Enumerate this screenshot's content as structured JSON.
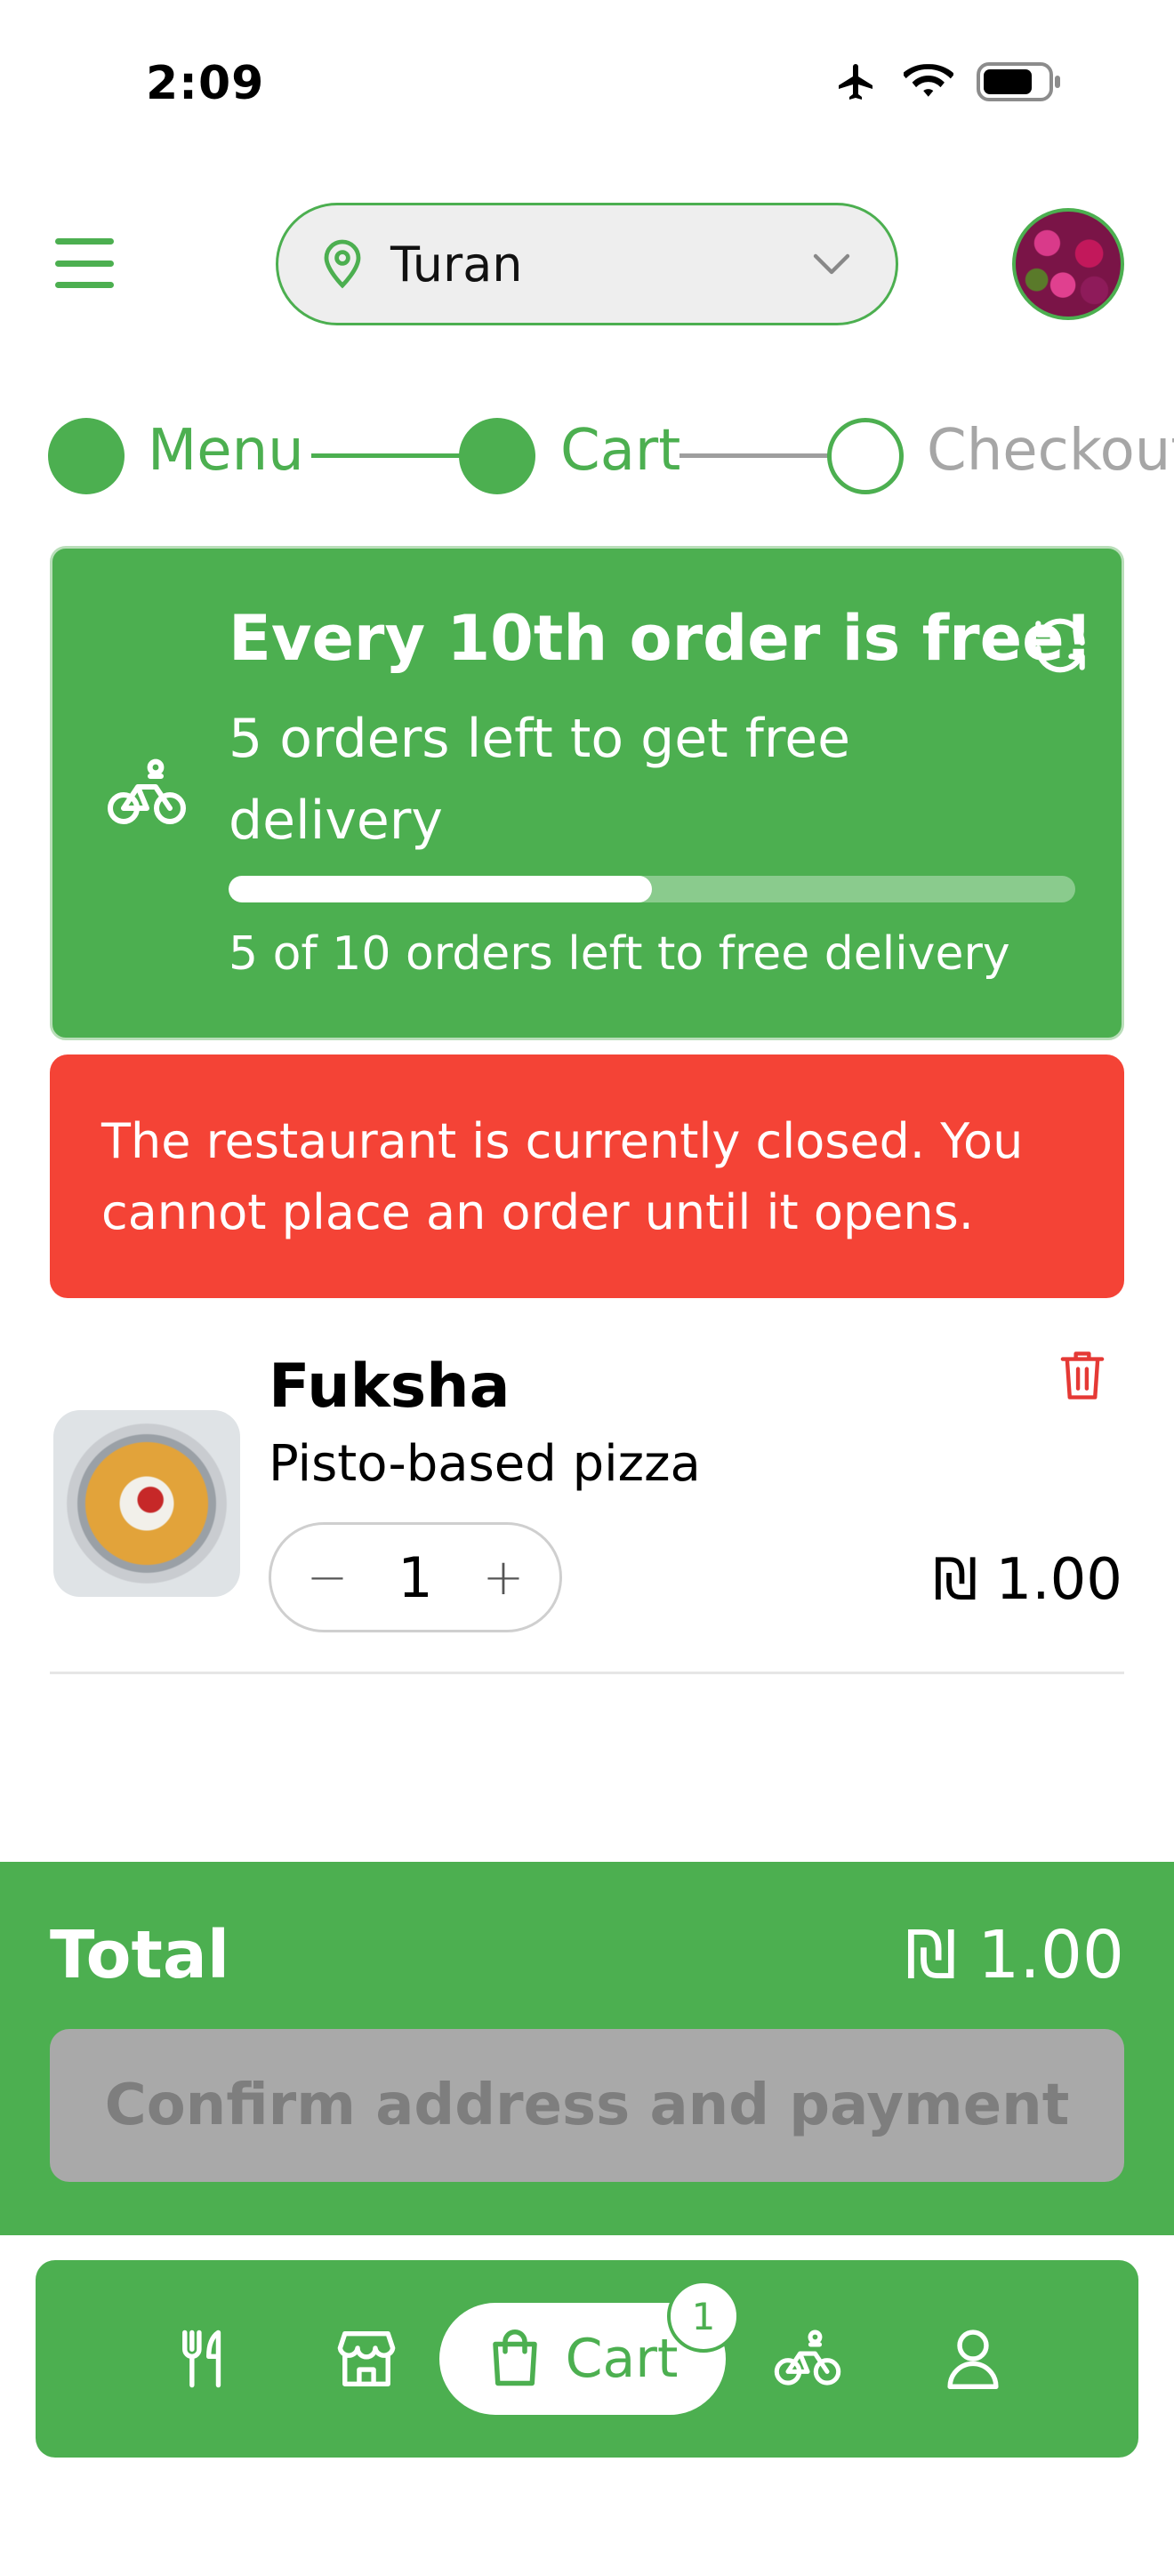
{
  "status_bar": {
    "time": "2:09"
  },
  "header": {
    "location": "Turan",
    "icons": [
      "hamburger-menu-icon",
      "location-pin-icon",
      "chevron-down-icon",
      "avatar"
    ]
  },
  "stepper": {
    "steps": [
      {
        "label": "Menu",
        "state": "completed"
      },
      {
        "label": "Cart",
        "state": "active"
      },
      {
        "label": "Checkout",
        "state": "pending"
      }
    ]
  },
  "rewards": {
    "title": "Every 10th order is free!",
    "subtitle": "5 orders left to get free delivery",
    "caption": "5 of 10 orders left to free delivery",
    "progress_fraction": 0.5
  },
  "closed_banner": {
    "message": "The restaurant is currently closed. You cannot place an order until it opens."
  },
  "cart_items": [
    {
      "name": "Fuksha",
      "description": "Pisto-based pizza",
      "quantity": "1",
      "price": "₪ 1.00"
    }
  ],
  "summary": {
    "total_label": "Total",
    "total_value": "₪ 1.00",
    "confirm_label": "Confirm address and payment",
    "confirm_enabled": false
  },
  "bottom_nav": {
    "items": [
      "menu",
      "store",
      "cart",
      "delivery",
      "profile"
    ],
    "cart_label": "Cart",
    "cart_badge": "1",
    "active": "cart"
  },
  "colors": {
    "primary": "#4caf50",
    "danger": "#f44336",
    "disabled": "#a9a9a9"
  }
}
